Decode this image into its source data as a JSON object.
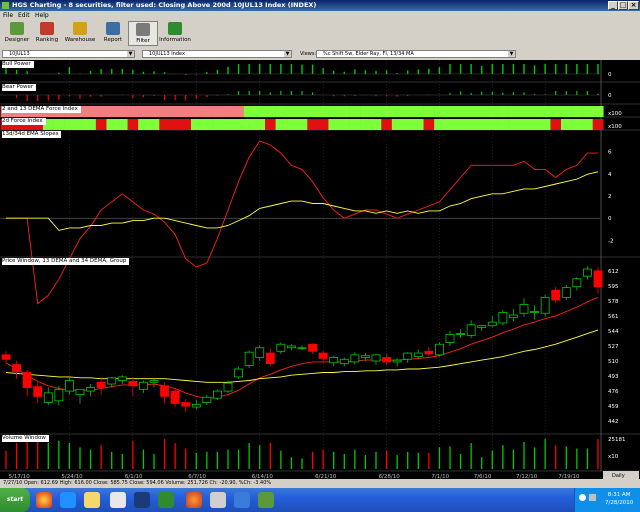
{
  "window": {
    "title": "HGS Charting - 8 securities, filter used: Closing Above 200d       10JUL13 Index (INDEX)"
  },
  "menu": [
    "File",
    "Edit",
    "Help"
  ],
  "toolbar": [
    {
      "label": "Designer",
      "icon": "designer-icon",
      "color": "#5a9a3a"
    },
    {
      "label": "Ranking",
      "icon": "ranking-icon",
      "color": "#c0392b"
    },
    {
      "label": "Warehouse",
      "icon": "warehouse-icon",
      "color": "#d4a017"
    },
    {
      "label": "Report",
      "icon": "report-icon",
      "color": "#3a6ea5"
    },
    {
      "label": "Filter",
      "icon": "filter-icon",
      "color": "#7a7a7a"
    },
    {
      "label": "Information",
      "icon": "information-icon",
      "color": "#2e8b2e"
    }
  ],
  "selectors": {
    "symbol": "10JUL13",
    "security": "10JUL13 Index",
    "views_label": "Views:",
    "view": "%c Shift 5w, Elder Ray, FI, 13/34 MA"
  },
  "panels": {
    "bull_power": "Bull Power",
    "bear_power": "Bear Power",
    "force_index_2_13": "2 and 13 DEMA  Force Index",
    "force_index_2d": "2d Force Index",
    "ema_slopes": "13d/34d EMA Slopes",
    "price": "Price Window, 13 DEMA and 34 DEMA, Group",
    "volume": "Volume Window"
  },
  "axis_labels": {
    "bull_power": [
      "0"
    ],
    "bear_power": [
      "0"
    ],
    "force_index": [
      "x100",
      "x100"
    ],
    "ema_slopes": [
      "6",
      "4",
      "2",
      "0",
      "-2"
    ],
    "price": [
      "612",
      "595",
      "578",
      "561",
      "544",
      "527",
      "510",
      "493",
      "476",
      "459",
      "442"
    ],
    "volume": [
      "25181",
      "x10"
    ],
    "corner": "Daily"
  },
  "dates": [
    "5/17/10",
    "5/24/10",
    "6/1/10",
    "6/7/10",
    "6/14/10",
    "6/21/10",
    "6/28/10",
    "7/1/10",
    "7/6/10",
    "7/12/10",
    "7/19/10"
  ],
  "colors": {
    "up": "#00cc00",
    "down": "#ff0000",
    "dema13": "#ff2020",
    "dema34": "#ffff40",
    "force_pos": "#7dff3a",
    "force_neg": "#e01010"
  },
  "status": "7/27/10  Open: 612.69  High: 616.00  Close: 585.75  Close: 594.06  Volume: 251,726  Ch: -20.90,  %Ch: -3.40%",
  "taskbar": {
    "start": "start",
    "time": "8:31 AM",
    "date": "7/28/2010"
  },
  "chart_data": {
    "type": "candlestick",
    "title": "Price Window, 13 DEMA and 34 DEMA, Group",
    "x_ticks": [
      "5/17/10",
      "5/24/10",
      "6/1/10",
      "6/7/10",
      "6/14/10",
      "6/21/10",
      "6/28/10",
      "7/1/10",
      "7/6/10",
      "7/12/10",
      "7/19/10"
    ],
    "y_ticks": [
      612,
      595,
      578,
      561,
      544,
      527,
      510,
      493,
      476,
      459,
      442
    ],
    "ylim": [
      432,
      622
    ],
    "candles": [
      {
        "o": 517,
        "h": 521,
        "c": 512,
        "l": 508
      },
      {
        "o": 506,
        "h": 510,
        "c": 498,
        "l": 490
      },
      {
        "o": 497,
        "h": 500,
        "c": 480,
        "l": 470
      },
      {
        "o": 481,
        "h": 486,
        "c": 470,
        "l": 463
      },
      {
        "o": 463,
        "h": 480,
        "c": 474,
        "l": 460
      },
      {
        "o": 465,
        "h": 482,
        "c": 478,
        "l": 460
      },
      {
        "o": 476,
        "h": 492,
        "c": 488,
        "l": 472
      },
      {
        "o": 472,
        "h": 478,
        "c": 478,
        "l": 462
      },
      {
        "o": 476,
        "h": 484,
        "c": 480,
        "l": 470
      },
      {
        "o": 486,
        "h": 490,
        "c": 480,
        "l": 472
      },
      {
        "o": 484,
        "h": 492,
        "c": 491,
        "l": 480
      },
      {
        "o": 488,
        "h": 494,
        "c": 492,
        "l": 484
      },
      {
        "o": 487,
        "h": 492,
        "c": 482,
        "l": 470
      },
      {
        "o": 478,
        "h": 488,
        "c": 486,
        "l": 474
      },
      {
        "o": 486,
        "h": 490,
        "c": 488,
        "l": 480
      },
      {
        "o": 482,
        "h": 486,
        "c": 470,
        "l": 462
      },
      {
        "o": 476,
        "h": 478,
        "c": 462,
        "l": 458
      },
      {
        "o": 463,
        "h": 467,
        "c": 459,
        "l": 452
      },
      {
        "o": 458,
        "h": 466,
        "c": 461,
        "l": 455
      },
      {
        "o": 463,
        "h": 472,
        "c": 469,
        "l": 460
      },
      {
        "o": 468,
        "h": 478,
        "c": 476,
        "l": 466
      },
      {
        "o": 476,
        "h": 488,
        "c": 485,
        "l": 474
      },
      {
        "o": 492,
        "h": 504,
        "c": 501,
        "l": 490
      },
      {
        "o": 505,
        "h": 522,
        "c": 520,
        "l": 502
      },
      {
        "o": 514,
        "h": 528,
        "c": 525,
        "l": 510
      },
      {
        "o": 519,
        "h": 524,
        "c": 507,
        "l": 504
      },
      {
        "o": 521,
        "h": 531,
        "c": 529,
        "l": 518
      },
      {
        "o": 525,
        "h": 529,
        "c": 527,
        "l": 522
      },
      {
        "o": 525,
        "h": 528,
        "c": 525,
        "l": 522
      },
      {
        "o": 529,
        "h": 530,
        "c": 521,
        "l": 518
      },
      {
        "o": 519,
        "h": 522,
        "c": 513,
        "l": 508
      },
      {
        "o": 508,
        "h": 516,
        "c": 514,
        "l": 504
      },
      {
        "o": 507,
        "h": 514,
        "c": 512,
        "l": 504
      },
      {
        "o": 509,
        "h": 520,
        "c": 517,
        "l": 506
      },
      {
        "o": 514,
        "h": 519,
        "c": 516,
        "l": 510
      },
      {
        "o": 510,
        "h": 518,
        "c": 517,
        "l": 506
      },
      {
        "o": 514,
        "h": 519,
        "c": 509,
        "l": 506
      },
      {
        "o": 509,
        "h": 513,
        "c": 511,
        "l": 504
      },
      {
        "o": 512,
        "h": 520,
        "c": 519,
        "l": 508
      },
      {
        "o": 515,
        "h": 523,
        "c": 519,
        "l": 512
      },
      {
        "o": 521,
        "h": 526,
        "c": 518,
        "l": 515
      },
      {
        "o": 517,
        "h": 531,
        "c": 529,
        "l": 515
      },
      {
        "o": 531,
        "h": 544,
        "c": 540,
        "l": 527
      },
      {
        "o": 540,
        "h": 546,
        "c": 541,
        "l": 536
      },
      {
        "o": 539,
        "h": 556,
        "c": 551,
        "l": 536
      },
      {
        "o": 548,
        "h": 551,
        "c": 550,
        "l": 544
      },
      {
        "o": 550,
        "h": 561,
        "c": 554,
        "l": 548
      },
      {
        "o": 553,
        "h": 568,
        "c": 565,
        "l": 550
      },
      {
        "o": 559,
        "h": 569,
        "c": 562,
        "l": 555
      },
      {
        "o": 564,
        "h": 581,
        "c": 574,
        "l": 560
      },
      {
        "o": 565,
        "h": 573,
        "c": 566,
        "l": 557
      },
      {
        "o": 564,
        "h": 585,
        "c": 582,
        "l": 560
      },
      {
        "o": 590,
        "h": 594,
        "c": 579,
        "l": 576
      },
      {
        "o": 582,
        "h": 596,
        "c": 593,
        "l": 579
      },
      {
        "o": 594,
        "h": 605,
        "c": 603,
        "l": 590
      },
      {
        "o": 606,
        "h": 617,
        "c": 614,
        "l": 602
      },
      {
        "o": 612,
        "h": 616,
        "c": 594,
        "l": 586
      }
    ],
    "series": [
      {
        "name": "13 DEMA",
        "values": [
          508,
          501,
          494,
          487,
          482,
          479,
          477,
          477,
          477,
          479,
          481,
          483,
          483,
          483,
          484,
          482,
          479,
          474,
          470,
          468,
          469,
          472,
          477,
          484,
          491,
          495,
          500,
          504,
          507,
          509,
          509,
          509,
          509,
          510,
          511,
          511,
          511,
          511,
          512,
          513,
          514,
          516,
          520,
          524,
          529,
          533,
          537,
          542,
          546,
          551,
          554,
          558,
          561,
          566,
          571,
          577,
          582
        ]
      },
      {
        "name": "34 DEMA",
        "values": [
          497,
          496,
          495,
          494,
          493,
          492,
          492,
          491,
          491,
          490,
          490,
          490,
          490,
          490,
          490,
          490,
          489,
          488,
          487,
          486,
          486,
          486,
          487,
          488,
          490,
          491,
          492,
          494,
          495,
          496,
          497,
          497,
          498,
          498,
          499,
          499,
          500,
          500,
          501,
          501,
          502,
          503,
          505,
          507,
          509,
          511,
          513,
          515,
          518,
          521,
          523,
          526,
          529,
          533,
          537,
          541,
          545
        ]
      }
    ]
  }
}
